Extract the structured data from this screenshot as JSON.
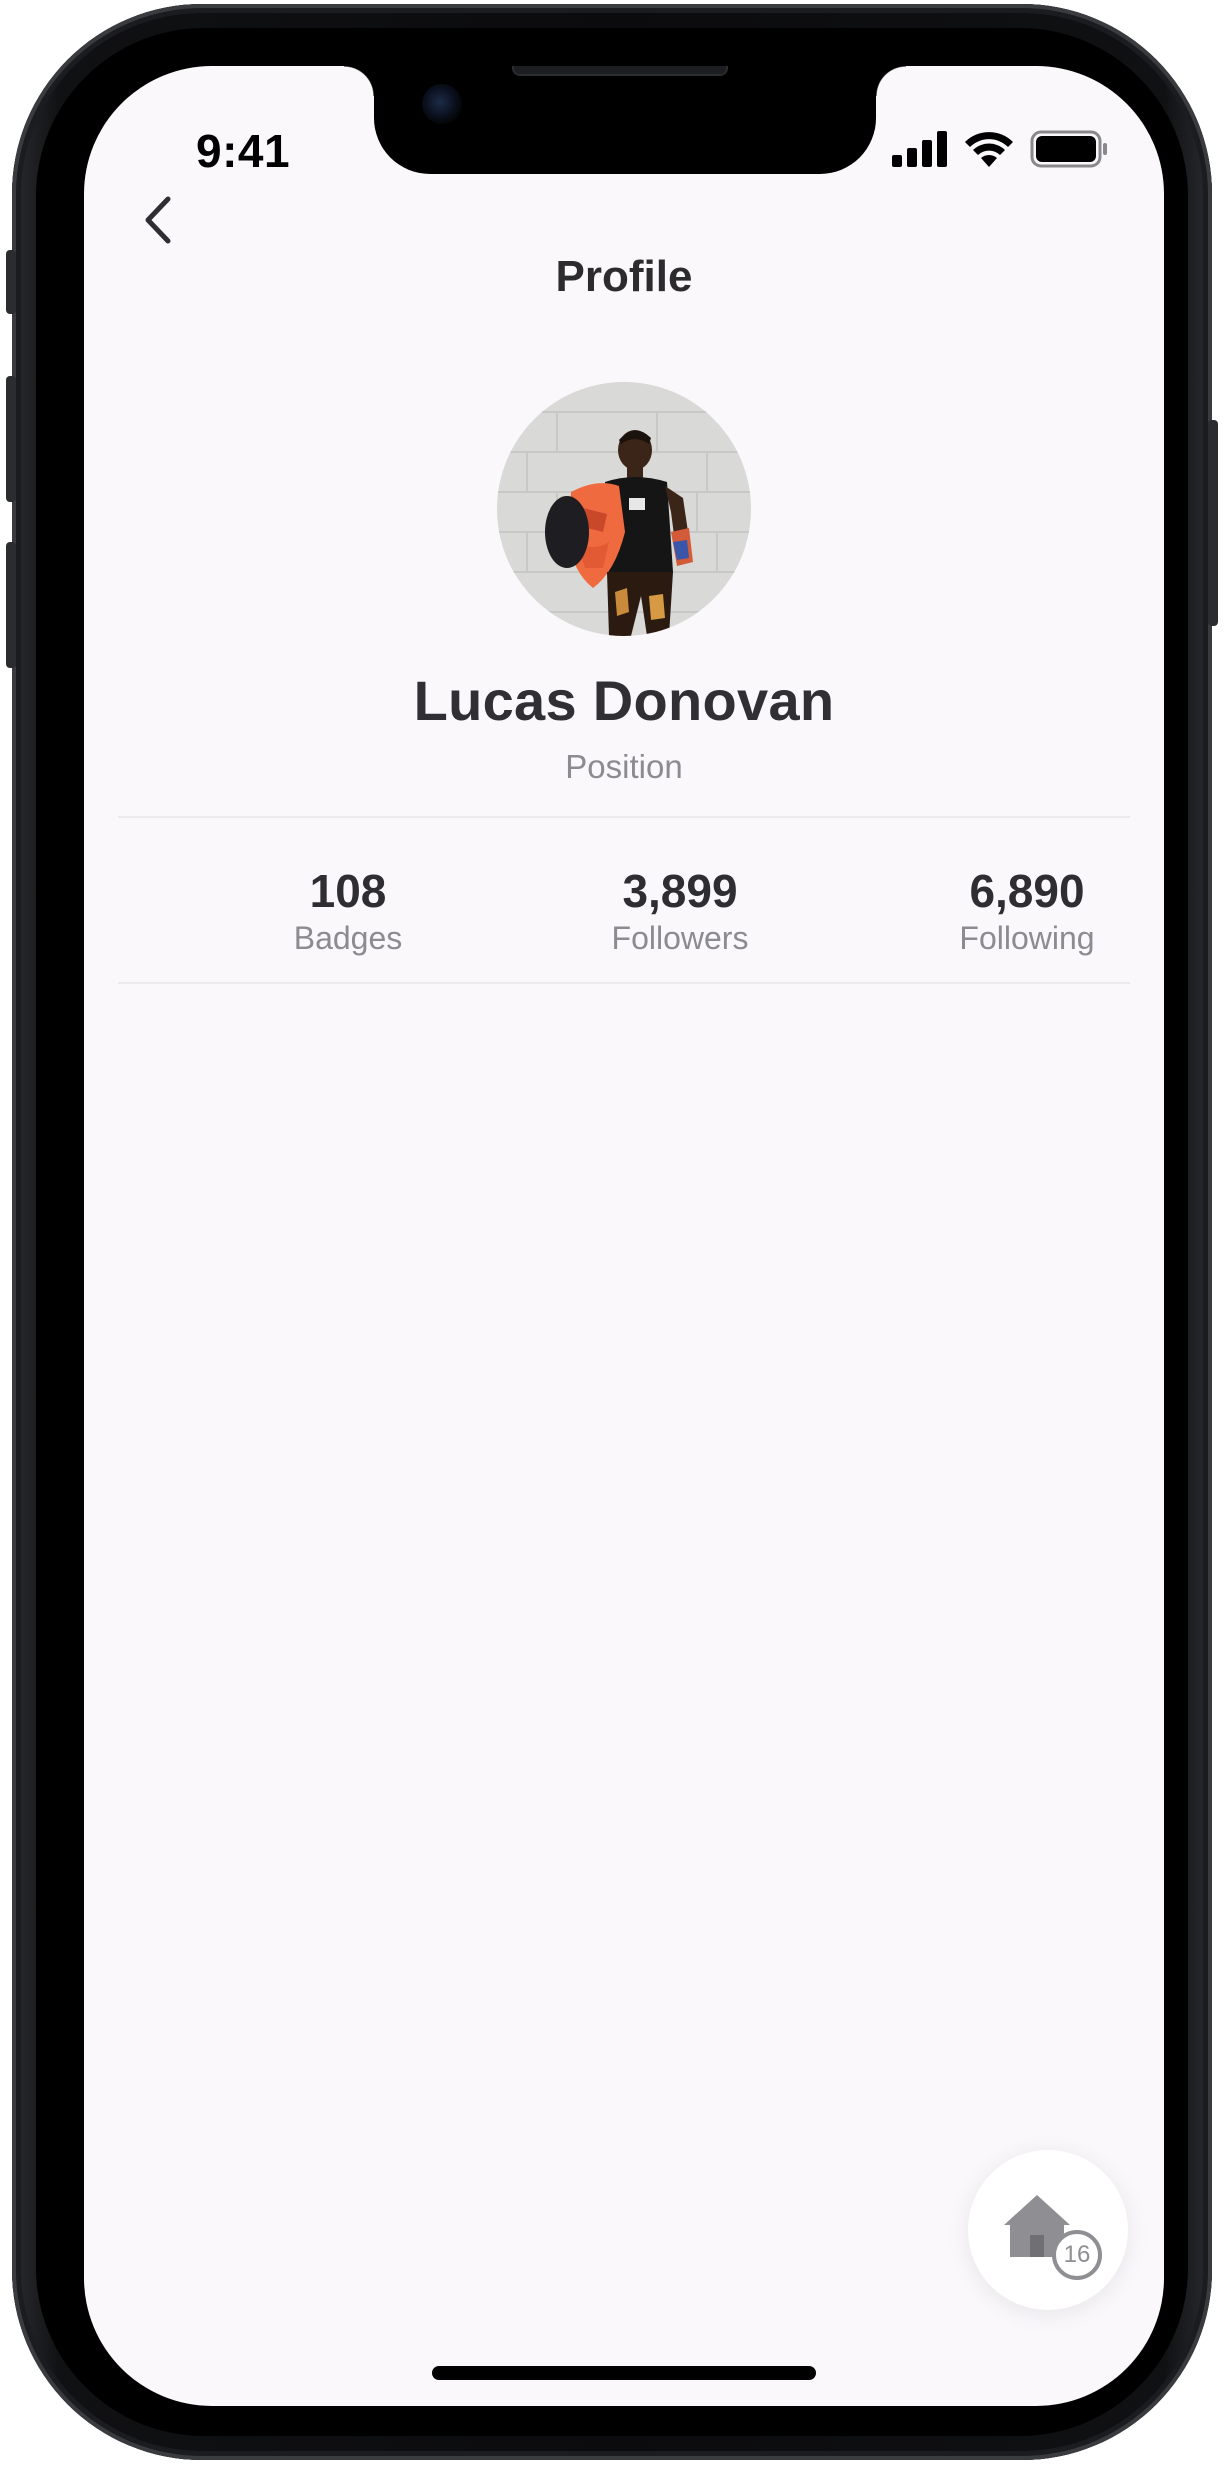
{
  "status_bar": {
    "time": "9:41"
  },
  "nav": {
    "title": "Profile",
    "back_icon": "chevron-left-icon"
  },
  "profile": {
    "name": "Lucas Donovan",
    "position": "Position"
  },
  "stats": [
    {
      "value": "108",
      "label": "Badges"
    },
    {
      "value": "3,899",
      "label": "Followers"
    },
    {
      "value": "6,890",
      "label": "Following"
    }
  ],
  "fab": {
    "icon": "home-icon",
    "badge": "16"
  },
  "colors": {
    "background": "#faf8fb",
    "text_primary": "#2e2e32",
    "text_secondary": "#8b8b90",
    "divider": "#ecebee"
  }
}
